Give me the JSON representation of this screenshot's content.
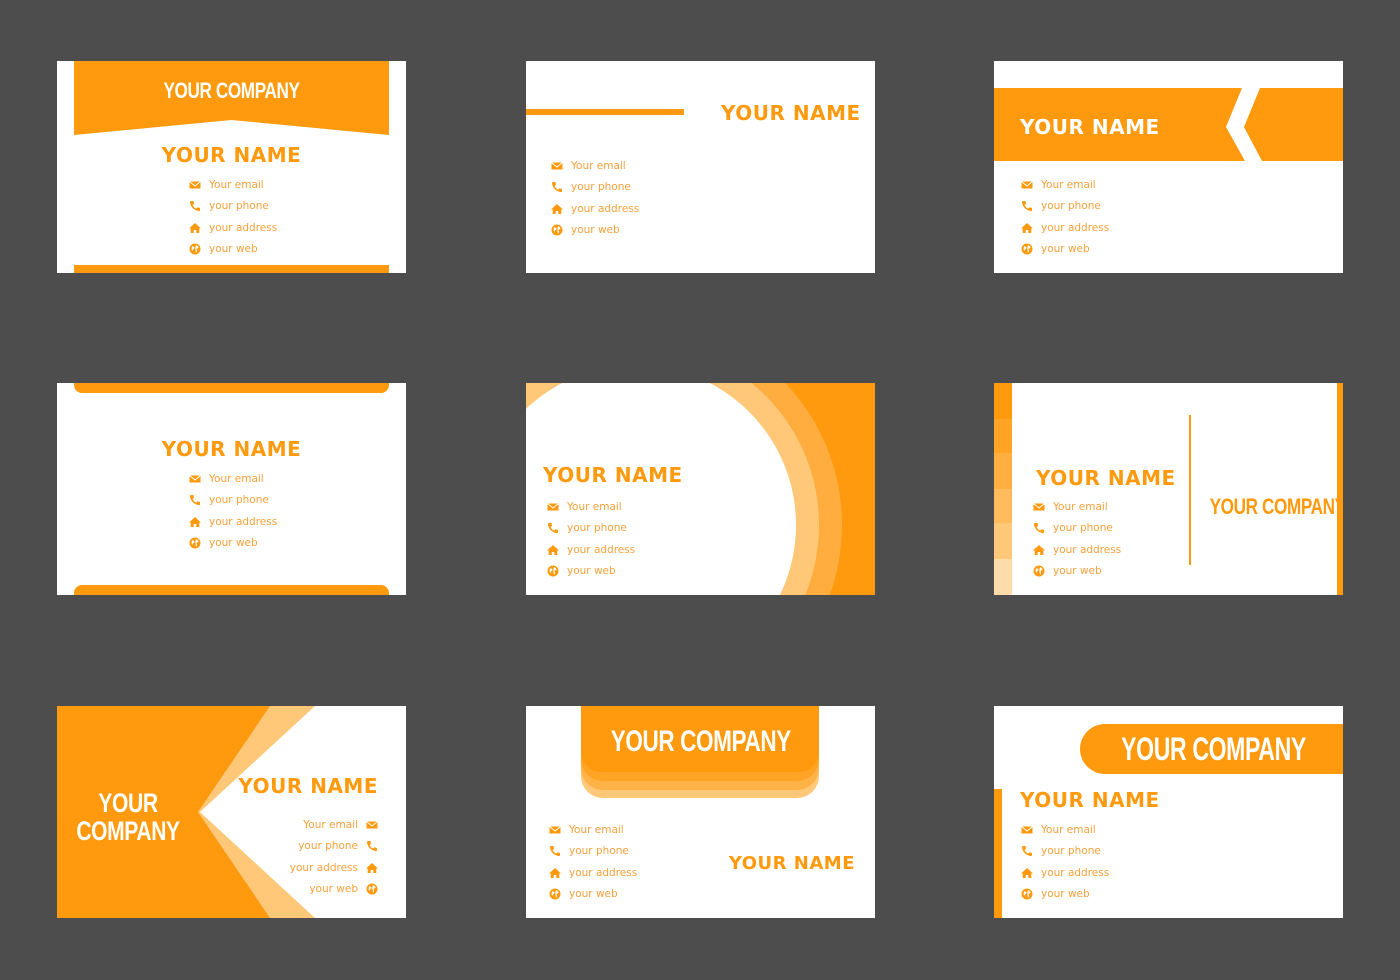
{
  "colors": {
    "background": "#4d4d4d",
    "accent": "#ff9a0e",
    "accent_light": "#ffc878",
    "card": "#ffffff"
  },
  "contact_icons": [
    "envelope-icon",
    "phone-icon",
    "home-icon",
    "globe-icon"
  ],
  "cards": [
    {
      "company": "YOUR COMPANY",
      "name": "YOUR NAME",
      "contacts": [
        "Your email",
        "your phone",
        "your address",
        "your web"
      ]
    },
    {
      "name": "YOUR NAME",
      "contacts": [
        "Your email",
        "your phone",
        "your address",
        "your web"
      ]
    },
    {
      "name": "YOUR NAME",
      "contacts": [
        "Your email",
        "your phone",
        "your address",
        "your web"
      ]
    },
    {
      "name": "YOUR NAME",
      "contacts": [
        "Your email",
        "your phone",
        "your address",
        "your web"
      ]
    },
    {
      "name": "YOUR NAME",
      "contacts": [
        "Your email",
        "your phone",
        "your address",
        "your web"
      ]
    },
    {
      "company": "YOUR COMPANY",
      "name": "YOUR NAME",
      "contacts": [
        "Your email",
        "your phone",
        "your address",
        "your web"
      ]
    },
    {
      "company_line1": "YOUR",
      "company_line2": "COMPANY",
      "name": "YOUR NAME",
      "contacts": [
        "Your email",
        "your phone",
        "your address",
        "your web"
      ]
    },
    {
      "company": "YOUR COMPANY",
      "name": "YOUR NAME",
      "contacts": [
        "Your email",
        "your phone",
        "your address",
        "your web"
      ]
    },
    {
      "company": "YOUR COMPANY",
      "name": "YOUR NAME",
      "contacts": [
        "Your email",
        "your phone",
        "your address",
        "your web"
      ]
    }
  ]
}
